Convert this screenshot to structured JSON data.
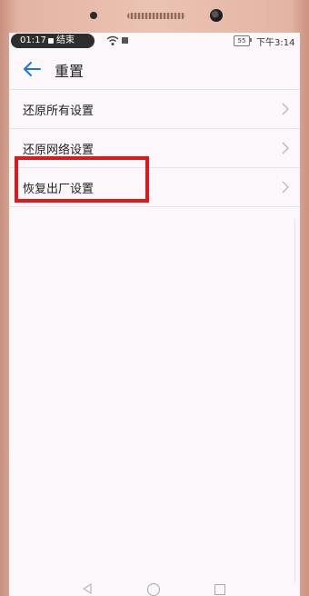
{
  "status": {
    "recording_time": "01:17",
    "recording_end": "结束",
    "battery": "55",
    "clock": "下午3:14"
  },
  "header": {
    "back_icon": "arrow-left-icon",
    "title": "重置"
  },
  "settings": [
    {
      "label": "还原所有设置"
    },
    {
      "label": "还原网络设置"
    },
    {
      "label": "恢复出厂设置"
    }
  ],
  "colors": {
    "accent": "#1a73e8",
    "highlight": "#e01818"
  }
}
